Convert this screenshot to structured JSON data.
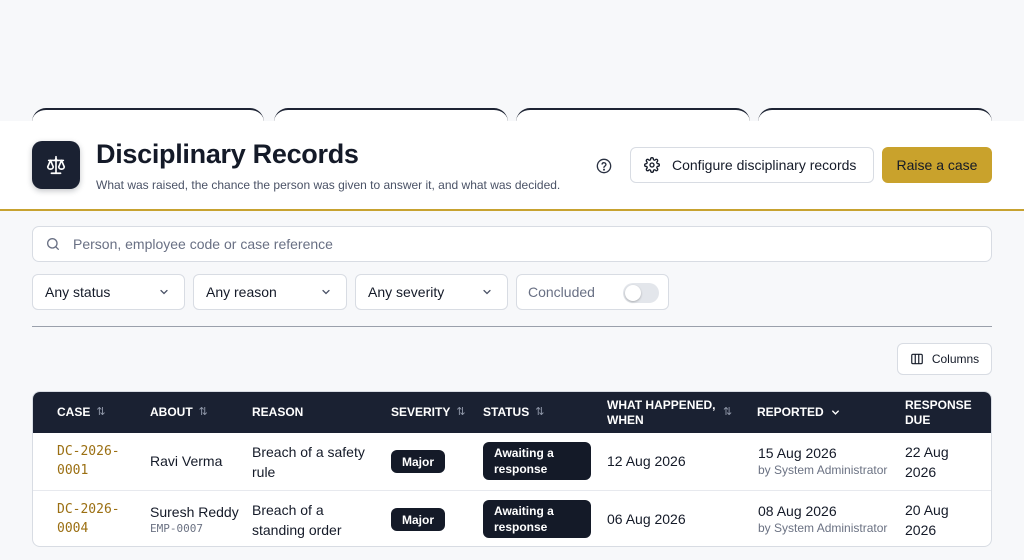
{
  "header": {
    "title": "Disciplinary Records",
    "subtitle": "What was raised, the chance the person was given to answer it, and what was decided.",
    "configure_label": "Configure disciplinary records",
    "raise_label": "Raise a case"
  },
  "search": {
    "placeholder": "Person, employee code or case reference"
  },
  "filters": {
    "status": "Any status",
    "reason": "Any reason",
    "severity": "Any severity",
    "concluded_label": "Concluded",
    "concluded_on": false
  },
  "columns_label": "Columns",
  "table": {
    "headers": {
      "case": "CASE",
      "about": "ABOUT",
      "reason": "REASON",
      "severity": "SEVERITY",
      "status": "STATUS",
      "what_happened": "WHAT HAPPENED, WHEN",
      "reported": "REPORTED",
      "response_due": "RESPONSE DUE"
    },
    "rows": [
      {
        "case": "DC-2026-0001",
        "person": "Ravi Verma",
        "employee_code": "",
        "reason": "Breach of a safety rule",
        "severity": "Major",
        "status": "Awaiting a response",
        "happened": "12 Aug 2026",
        "reported": "15 Aug 2026",
        "reported_by": "by System Administrator",
        "response_due": "22 Aug 2026"
      },
      {
        "case": "DC-2026-0004",
        "person": "Suresh Reddy",
        "employee_code": "EMP-0007",
        "reason": "Breach of a standing order",
        "severity": "Major",
        "status": "Awaiting a response",
        "happened": "06 Aug 2026",
        "reported": "08 Aug 2026",
        "reported_by": "by System Administrator",
        "response_due": "20 Aug 2026"
      }
    ]
  },
  "colors": {
    "brand_dark": "#1a2132",
    "accent_gold": "#c9a22c",
    "case_link": "#9b6f12"
  },
  "icons": [
    "scales-icon",
    "help-circle-icon",
    "gear-icon",
    "search-icon",
    "chevron-down-icon",
    "columns-icon",
    "sort-icon"
  ]
}
